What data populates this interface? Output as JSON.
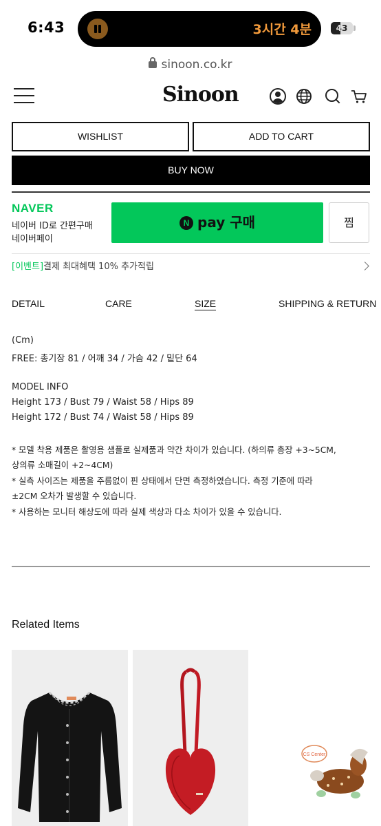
{
  "status_bar": {
    "time": "6:43",
    "timer": "3시간 4분",
    "battery_percent": "43",
    "battery_level": 0.43
  },
  "browser": {
    "url": "sinoon.co.kr"
  },
  "header": {
    "logo": "Sinoon"
  },
  "actions": {
    "wishlist": "WISHLIST",
    "add_to_cart": "ADD TO CART",
    "buy_now": "BUY NOW"
  },
  "naver": {
    "brand": "NAVER",
    "line1": "네이버 ID로 간편구매",
    "line2": "네이버페이",
    "pay_n": "N",
    "pay_label": "pay 구매",
    "jjim": "찜",
    "event_tag": "[이벤트]",
    "event_text": "결제 최대혜택 10% 추가적립"
  },
  "tabs": {
    "detail": "DETAIL",
    "care": "CARE",
    "size": "SIZE",
    "shipping": "SHIPPING & RETURN",
    "active": "SIZE"
  },
  "size_info": {
    "unit": "(Cm)",
    "free": "FREE: 총기장 81 / 어깨 34 / 가슴 42 / 밑단 64",
    "model_title": "MODEL INFO",
    "model1": "Height 173 / Bust 79 / Waist 58 / Hips 89",
    "model2": "Height 172 / Bust 74 / Waist 58 / Hips 89",
    "note1a": "* 모델 착용 제품은 촬영용 샘플로 실제품과 약간 차이가 있습니다. (하의류 총장 +3~5CM,",
    "note1b": "상의류 소매길이 +2~4CM)",
    "note2a": "* 실측 사이즈는 제품을 주름없이 핀 상태에서 단면 측정하였습니다. 측정 기준에 따라",
    "note2b": "±2CM 오차가 발생할 수 있습니다.",
    "note3": "* 사용하는 모니터 해상도에 따라 실제 색상과 다소 차이가 있을 수 있습니다."
  },
  "related": {
    "title": "Related Items",
    "items": [
      {
        "kind": "black cardigan"
      },
      {
        "kind": "red heart pouch"
      }
    ]
  },
  "cs_widget": {
    "label": "CS Center"
  },
  "colors": {
    "naver_green": "#03c75a",
    "timer_orange": "#f29a3b",
    "black": "#000000"
  }
}
